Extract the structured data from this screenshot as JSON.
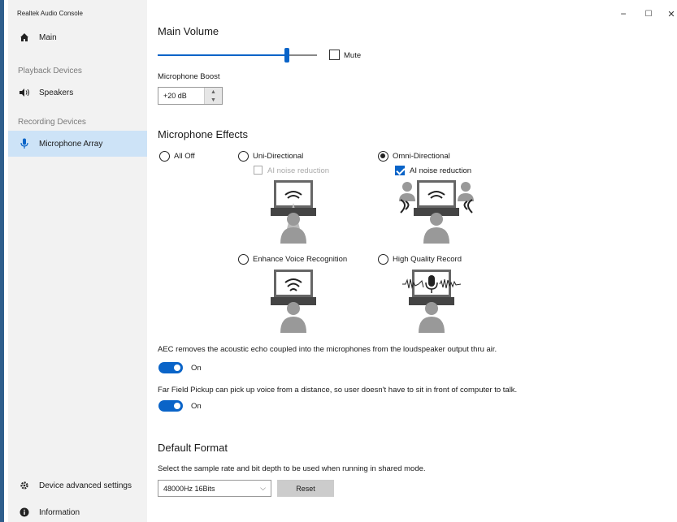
{
  "app": {
    "title": "Realtek Audio Console"
  },
  "window_controls": {
    "minimize": "−",
    "maximize": "☐",
    "close": "✕"
  },
  "sidebar": {
    "main": "Main",
    "playback_section": "Playback Devices",
    "speakers": "Speakers",
    "recording_section": "Recording Devices",
    "microphone_array": "Microphone Array",
    "device_advanced": "Device advanced settings",
    "information": "Information"
  },
  "main_volume": {
    "title": "Main Volume",
    "level": 0.81,
    "mute_label": "Mute",
    "mute_checked": false
  },
  "mic_boost": {
    "label": "Microphone Boost",
    "value": "+20 dB"
  },
  "effects": {
    "title": "Microphone Effects",
    "all_off": "All Off",
    "uni": "Uni-Directional",
    "uni_ai": "AI noise reduction",
    "omni": "Omni-Directional",
    "omni_ai": "AI noise reduction",
    "enhance": "Enhance Voice Recognition",
    "hq": "High Quality Record",
    "selected": "omni"
  },
  "aec": {
    "text": "AEC removes the acoustic echo coupled into the microphones from the loudspeaker output thru air.",
    "state": "On"
  },
  "far_field": {
    "text": "Far Field Pickup can pick up voice from a distance, so user doesn't have to sit in front of computer to talk.",
    "state": "On"
  },
  "default_format": {
    "title": "Default Format",
    "description": "Select the sample rate and bit depth to be used when running in shared mode.",
    "selected": "48000Hz 16Bits",
    "reset_label": "Reset"
  },
  "colors": {
    "accent": "#0a64c8",
    "sidebar_bg": "#f2f2f2",
    "selected_bg": "#cde3f7"
  }
}
